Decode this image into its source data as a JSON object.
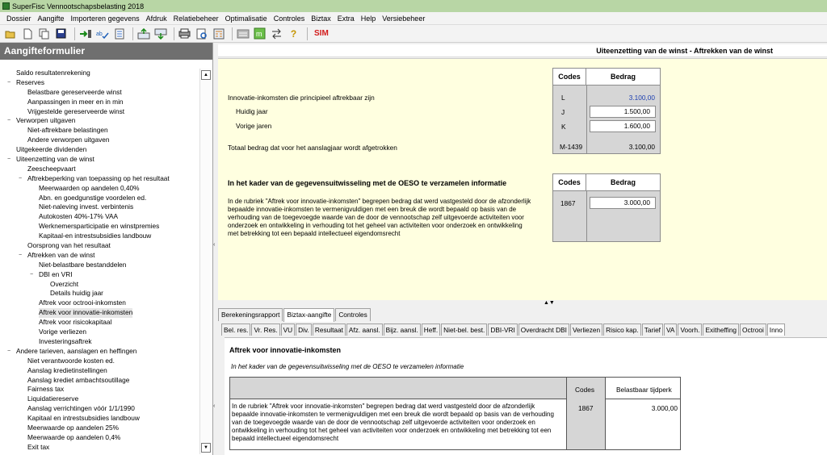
{
  "window": {
    "title": "SuperFisc Vennootschapsbelasting 2018"
  },
  "menu": [
    "Dossier",
    "Aangifte",
    "Importeren gegevens",
    "Afdruk",
    "Relatiebeheer",
    "Optimalisatie",
    "Controles",
    "Biztax",
    "Extra",
    "Help",
    "Versiebeheer"
  ],
  "toolbar": {
    "sim_label": "SIM"
  },
  "sidebar": {
    "title": "Aangifteformulier",
    "items": [
      {
        "label": "Saldo resultatenrekening",
        "level": 0,
        "exp": ""
      },
      {
        "label": "Reserves",
        "level": 0,
        "exp": "-"
      },
      {
        "label": "Belastbare gereserveerde winst",
        "level": 1,
        "exp": ""
      },
      {
        "label": "Aanpassingen in meer en in min",
        "level": 1,
        "exp": ""
      },
      {
        "label": "Vrijgestelde gereserveerde winst",
        "level": 1,
        "exp": ""
      },
      {
        "label": "Verworpen uitgaven",
        "level": 0,
        "exp": "-"
      },
      {
        "label": "Niet-aftrekbare belastingen",
        "level": 1,
        "exp": ""
      },
      {
        "label": "Andere verworpen uitgaven",
        "level": 1,
        "exp": ""
      },
      {
        "label": "Uitgekeerde dividenden",
        "level": 0,
        "exp": ""
      },
      {
        "label": "Uiteenzetting van de winst",
        "level": 0,
        "exp": "-"
      },
      {
        "label": "Zeescheepvaart",
        "level": 1,
        "exp": ""
      },
      {
        "label": "Aftrekbeperking van toepassing op het resultaat",
        "level": 1,
        "exp": "-"
      },
      {
        "label": "Meerwaarden op aandelen 0,40%",
        "level": 2,
        "exp": ""
      },
      {
        "label": "Abn. en goedgunstige voordelen ed.",
        "level": 2,
        "exp": ""
      },
      {
        "label": "Niet-naleving invest. verbintenis",
        "level": 2,
        "exp": ""
      },
      {
        "label": "Autokosten 40%-17% VAA",
        "level": 2,
        "exp": ""
      },
      {
        "label": "Werknemersparticipatie en winstpremies",
        "level": 2,
        "exp": ""
      },
      {
        "label": "Kapitaal-en intrestsubsidies landbouw",
        "level": 2,
        "exp": ""
      },
      {
        "label": "Oorsprong van het resultaat",
        "level": 1,
        "exp": ""
      },
      {
        "label": "Aftrekken van de winst",
        "level": 1,
        "exp": "-"
      },
      {
        "label": "Niet-belastbare bestanddelen",
        "level": 2,
        "exp": ""
      },
      {
        "label": "DBI en VRI",
        "level": 2,
        "exp": "-"
      },
      {
        "label": "Overzicht",
        "level": 3,
        "exp": ""
      },
      {
        "label": "Details huidig jaar",
        "level": 3,
        "exp": ""
      },
      {
        "label": "Aftrek voor octrooi-inkomsten",
        "level": 2,
        "exp": ""
      },
      {
        "label": "Aftrek voor innovatie-inkomsten",
        "level": 2,
        "exp": "",
        "selected": true
      },
      {
        "label": "Aftrek voor risicokapitaal",
        "level": 2,
        "exp": ""
      },
      {
        "label": "Vorige verliezen",
        "level": 2,
        "exp": ""
      },
      {
        "label": "Investeringsaftrek",
        "level": 2,
        "exp": ""
      },
      {
        "label": "Andere tarieven, aanslagen en heffingen",
        "level": 0,
        "exp": "-"
      },
      {
        "label": "Niet verantwoorde kosten ed.",
        "level": 1,
        "exp": ""
      },
      {
        "label": "Aanslag kredietinstellingen",
        "level": 1,
        "exp": ""
      },
      {
        "label": "Aanslag krediet ambachtsoutillage",
        "level": 1,
        "exp": ""
      },
      {
        "label": "Fairness tax",
        "level": 1,
        "exp": ""
      },
      {
        "label": "Liquidatiereserve",
        "level": 1,
        "exp": ""
      },
      {
        "label": "Aanslag verrichtingen vóór 1/1/1990",
        "level": 1,
        "exp": ""
      },
      {
        "label": "Kapitaal en intrestsubsidies landbouw",
        "level": 1,
        "exp": ""
      },
      {
        "label": "Meerwaarde op aandelen 25%",
        "level": 1,
        "exp": ""
      },
      {
        "label": "Meerwaarde op aandelen 0,4%",
        "level": 1,
        "exp": ""
      },
      {
        "label": "Exit tax",
        "level": 1,
        "exp": ""
      }
    ]
  },
  "main": {
    "title": "Uiteenzetting van de winst - Aftrekken van de winst",
    "section1": {
      "hdr_codes": "Codes",
      "hdr_bedrag": "Bedrag",
      "label_principal": "Innovatie-inkomsten die principieel aftrekbaar zijn",
      "label_huidig": "Huidig jaar",
      "label_vorige": "Vorige jaren",
      "label_totaal": "Totaal bedrag dat voor het aanslagjaar wordt afgetrokken",
      "code_l": "L",
      "val_l": "3.100,00",
      "code_j": "J",
      "val_j": "1.500,00",
      "code_k": "K",
      "val_k": "1.600,00",
      "code_m": "M-1439",
      "val_m": "3.100,00"
    },
    "section2": {
      "title": "In het kader van de gegevensuitwisseling met de OESO te verzamelen informatie",
      "hdr_codes": "Codes",
      "hdr_bedrag": "Bedrag",
      "text": "In de rubriek \"Aftrek voor innovatie-inkomsten\" begrepen bedrag dat werd vastgesteld door de afzonderlijk bepaalde innovatie-inkomsten te vermenigvuldigen met een breuk die wordt bepaald op basis van de verhouding van de toegevoegde waarde van de door de vennootschap zelf uitgevoerde activiteiten voor onderzoek en ontwikkeling in verhouding tot het geheel van activiteiten voor onderzoek en ontwikkeling met betrekking tot een bepaald intellectueel eigendomsrecht",
      "code": "1867",
      "value": "3.000,00"
    }
  },
  "tabs_main": [
    "Berekeningsrapport",
    "Biztax-aangifte",
    "Controles"
  ],
  "tabs_main_active": 1,
  "tabs_sub": [
    "Bel. res.",
    "Vr. Res.",
    "VU",
    "Div.",
    "Resultaat",
    "Afz. aansl.",
    "Bijz. aansl.",
    "Heff.",
    "Niet-bel. best.",
    "DBI-VRI",
    "Overdracht DBI",
    "Verliezen",
    "Risico kap.",
    "Tarief",
    "VA",
    "Voorh.",
    "Exitheffing",
    "Octrooi",
    "Inno"
  ],
  "tabs_sub_active": 18,
  "report": {
    "title": "Aftrek voor innovatie-inkomsten",
    "subtitle": "In het kader van de gegevensuitwisseling met de OESO te verzamelen informatie",
    "hdr_codes": "Codes",
    "hdr_tijdperk": "Belastbaar tijdperk",
    "text": "In de rubriek \"Aftrek voor innovatie-inkomsten\" begrepen bedrag dat werd vastgesteld door de afzonderlijk bepaalde innovatie-inkomsten te vermenigvuldigen met een breuk die wordt bepaald op basis van de verhouding van de toegevoegde waarde van de door de vennootschap zelf uitgevoerde activiteiten voor onderzoek en ontwikkeling in verhouding tot het geheel van activiteiten voor onderzoek en ontwikkeling met betrekking tot een bepaald intellectueel eigendomsrecht",
    "code": "1867",
    "value": "3.000,00"
  }
}
